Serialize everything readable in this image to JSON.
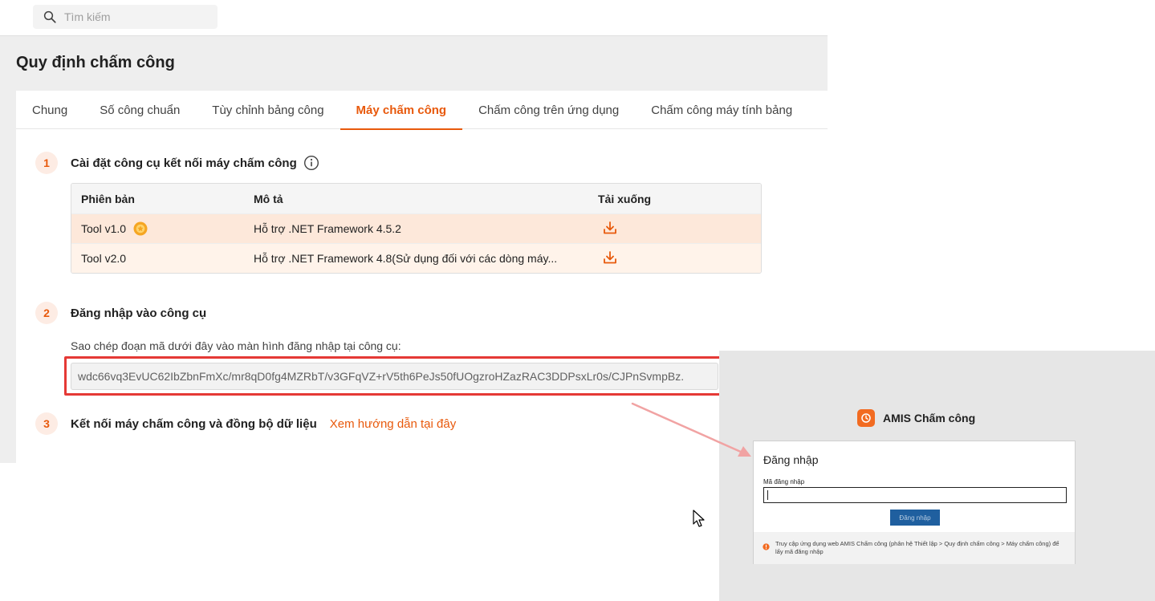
{
  "search": {
    "placeholder": "Tìm kiếm"
  },
  "page": {
    "title": "Quy định chấm công"
  },
  "tabs": [
    {
      "label": "Chung"
    },
    {
      "label": "Số công chuẩn"
    },
    {
      "label": "Tùy chỉnh bảng công"
    },
    {
      "label": "Máy chấm công",
      "active": true
    },
    {
      "label": "Chấm công trên ứng dụng"
    },
    {
      "label": "Chấm công máy tính bảng"
    }
  ],
  "steps": {
    "s1": {
      "num": "1",
      "title": "Cài đặt công cụ kết nối máy chấm công"
    },
    "s2": {
      "num": "2",
      "title": "Đăng nhập vào công cụ"
    },
    "s3": {
      "num": "3",
      "title": "Kết nối máy chấm công và đồng bộ dữ liệu",
      "link": "Xem hướng dẫn tại đây"
    }
  },
  "versions": {
    "headers": [
      "Phiên bản",
      "Mô tả",
      "Tải xuống"
    ],
    "rows": [
      {
        "version": "Tool v1.0",
        "desc": "Hỗ trợ .NET Framework 4.5.2",
        "recommended": true
      },
      {
        "version": "Tool v2.0",
        "desc": "Hỗ trợ .NET Framework 4.8(Sử dụng đối với các dòng máy..."
      }
    ]
  },
  "login_code": {
    "desc": "Sao chép đoạn mã dưới đây vào màn hình đăng nhập tại công cụ:",
    "code": "wdc66vq3EvUC62IbZbnFmXc/mr8qD0fg4MZRbT/v3GFqVZ+rV5th6PeJs50fUOgzroHZazRAC3DDPsxLr0s/CJPnSvmpBz."
  },
  "login_window": {
    "brand": "AMIS Chấm công",
    "title": "Đăng nhập",
    "field_label": "Mã đăng nhập",
    "field_value": "",
    "button": "Đăng nhập",
    "footer": "Truy cập ứng dụng web AMIS Chấm công (phân hệ Thiết lập > Quy định chấm công > Máy chấm công) để lấy mã đăng nhập"
  },
  "colors": {
    "accent": "#e8590c",
    "highlight": "#e53935",
    "login_button": "#1f5f9f"
  },
  "icons": [
    "search-icon",
    "info-icon",
    "badge-icon",
    "download-icon",
    "amis-logo-icon",
    "warning-icon",
    "mouse-cursor-icon",
    "arrow-annotation"
  ]
}
